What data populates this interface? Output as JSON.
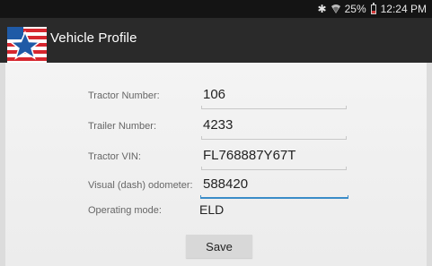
{
  "status_bar": {
    "bluetooth_icon": "bluetooth-icon",
    "wifi_icon": "wifi-icon",
    "battery_percent": "25%",
    "battery_level": 0.25,
    "time": "12:24 PM"
  },
  "app_bar": {
    "logo_icon": "star-flag-logo",
    "title": "Vehicle Profile"
  },
  "form": {
    "fields": [
      {
        "label": "Tractor Number:",
        "value": "106"
      },
      {
        "label": "Trailer Number:",
        "value": "4233"
      },
      {
        "label": "Tractor VIN:",
        "value": "FL768887Y67T"
      },
      {
        "label": "Visual (dash) odometer:",
        "value": "588420"
      }
    ],
    "operating_mode": {
      "label": "Operating mode:",
      "value": "ELD"
    },
    "save_label": "Save"
  },
  "colors": {
    "app_bar": "#2a2a2a",
    "status_bar": "#141414",
    "focus_underline": "#3a8cc8",
    "logo_red": "#d6262e",
    "logo_blue": "#1f5aa6"
  }
}
